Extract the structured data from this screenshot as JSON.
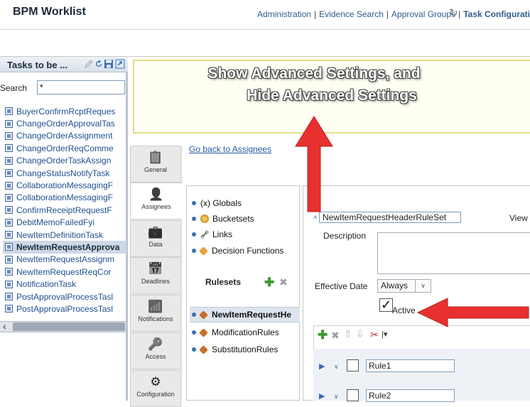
{
  "app": {
    "title": "BPM Worklist"
  },
  "nav": {
    "links": [
      "Administration",
      "Evidence Search",
      "Approval Groups",
      "Task Configurati"
    ],
    "separator": "|"
  },
  "tasks_panel": {
    "title": "Tasks to be ...",
    "search_label": "Search",
    "search_value": "*",
    "items": [
      "BuyerConfirmRcptReques",
      "ChangeOrderApprovalTas",
      "ChangeOrderAssignment",
      "ChangeOrderReqComme",
      "ChangeOrderTaskAssign",
      "ChangeStatusNotifyTask",
      "CollaborationMessagingF",
      "CollaborationMessagingF",
      "ConfirmReceiptRequestF",
      "DebitMemoFailedFyi",
      "NewItemDefinitionTask",
      "NewItemRequestApprova",
      "NewItemRequestAssignm",
      "NewItemRequestReqCor",
      "NotificationTask",
      "PostApprovalProcessTasl",
      "PostApprovalProcessTasl"
    ],
    "selected_index": 11
  },
  "annotation": {
    "line1": "Show Advanced Settings, and",
    "line2": "Hide Advanced Settings"
  },
  "back_link": "Go back to Assignees",
  "tabs": [
    {
      "label": "General",
      "icon": "clipboard-icon"
    },
    {
      "label": "Assignees",
      "icon": "person-icon"
    },
    {
      "label": "Data",
      "icon": "briefcase-icon"
    },
    {
      "label": "Deadlines",
      "icon": "calendar-icon"
    },
    {
      "label": "Notifications",
      "icon": "rss-icon"
    },
    {
      "label": "Access",
      "icon": "key-icon"
    },
    {
      "label": "Configuration",
      "icon": "gear-icon"
    }
  ],
  "active_tab": "Assignees",
  "rules_browser": {
    "nodes": [
      "(x) Globals",
      "Bucketsets",
      "Links",
      "Decision Functions"
    ],
    "rulesets_label": "Rulesets",
    "rulesets": [
      "NewItemRequestHe",
      "ModificationRules",
      "SubstitutionRules"
    ],
    "selected_ruleset": "NewItemRequestHe"
  },
  "ruleset_detail": {
    "name": "NewItemRequestHeaderRuleSet",
    "view_label": "View",
    "description_label": "Description",
    "description_value": "",
    "effective_date_label": "Effective Date",
    "effective_date_value": "Always",
    "active_label": "Active",
    "active_checked": true
  },
  "rules": [
    {
      "name": "Rule1",
      "checked": false
    },
    {
      "name": "Rule2",
      "checked": false
    }
  ],
  "colors": {
    "link": "#2d5d8f",
    "annotation_arrow": "#e8302e",
    "selected_row": "#cdd8e6"
  }
}
